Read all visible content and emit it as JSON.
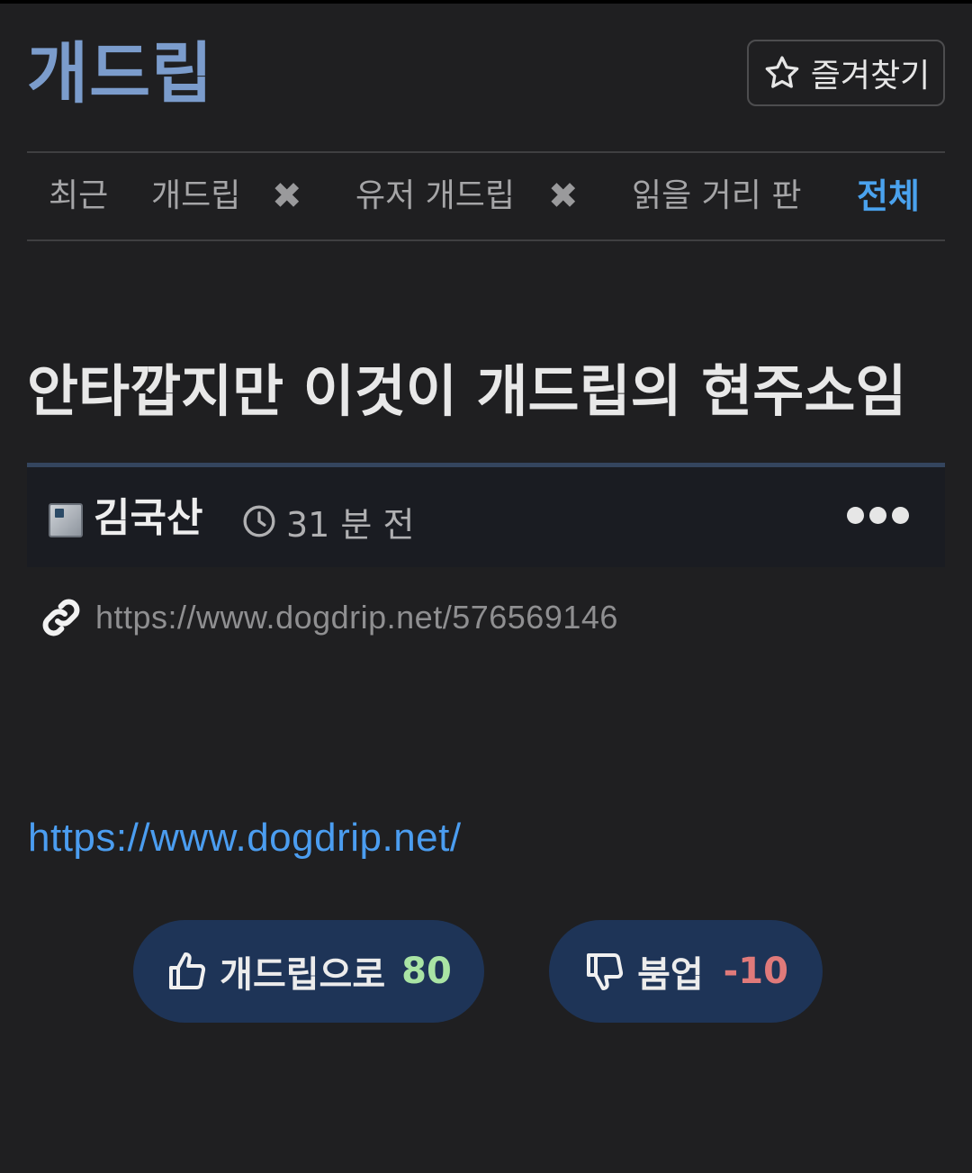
{
  "header": {
    "logo": "개드립",
    "favorite_label": "즐겨찾기"
  },
  "tabs": [
    {
      "label": "최근"
    },
    {
      "label": "개드립",
      "closable": true
    },
    {
      "label": "유저 개드립",
      "closable": true
    },
    {
      "label": "읽을 거리 판"
    },
    {
      "label": "전체",
      "active": true
    }
  ],
  "tab_close_glyph": "✖",
  "post": {
    "title": "안타깝지만 이것이 개드립의 현주소임",
    "author": "김국산",
    "time": "31 분 전",
    "permalink": "https://www.dogdrip.net/576569146",
    "body_link": "https://www.dogdrip.net/"
  },
  "votes": {
    "up_label": "개드립으로",
    "up_count": "80",
    "down_label": "붐업",
    "down_count": "-10"
  },
  "icons": {
    "favorite": "star-outline-icon",
    "time": "clock-icon",
    "more": "ellipsis-icon",
    "link": "link-icon",
    "up": "thumbs-up-icon",
    "down": "thumbs-down-icon"
  },
  "colors": {
    "background": "#1f1f21",
    "logo": "#7b9ccc",
    "active_tab": "#4aa2ee",
    "link": "#4b9df0",
    "vote_button": "#1e3457",
    "up_count": "#a9e4a4",
    "down_count": "#e07a7a"
  }
}
